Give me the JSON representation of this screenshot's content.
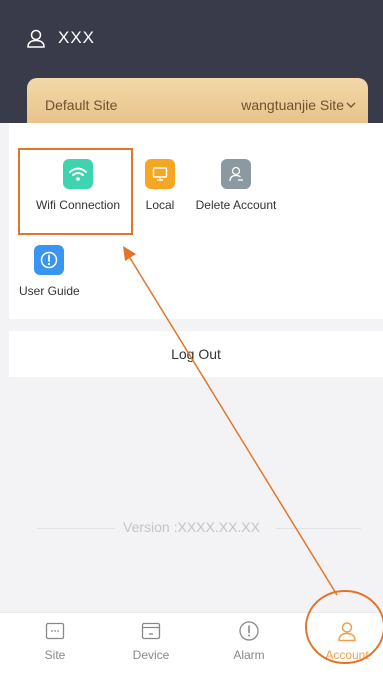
{
  "header": {
    "username": "XXX",
    "user_icon": "user-outline-icon"
  },
  "site": {
    "label": "Default Site",
    "value": "wangtuanjie Site"
  },
  "tiles": [
    {
      "label": "Wifi Connection",
      "icon": "wifi-icon",
      "color": "#3fd3b0"
    },
    {
      "label": "Local",
      "icon": "monitor-icon",
      "color": "#f5a623"
    },
    {
      "label": "Delete Account",
      "icon": "delete-account-icon",
      "color": "#8a9aa0"
    },
    {
      "label": "User Guide",
      "icon": "guide-icon",
      "color": "#3a95f0"
    }
  ],
  "logout_label": "Log Out",
  "version_text": "Version :XXXX.XX.XX",
  "tabs": [
    {
      "label": "Site",
      "icon": "site-icon",
      "active": false
    },
    {
      "label": "Device",
      "icon": "device-icon",
      "active": false
    },
    {
      "label": "Alarm",
      "icon": "alarm-icon",
      "active": false
    },
    {
      "label": "Account",
      "icon": "account-icon",
      "active": true
    }
  ],
  "accent_color": "#e3752a"
}
